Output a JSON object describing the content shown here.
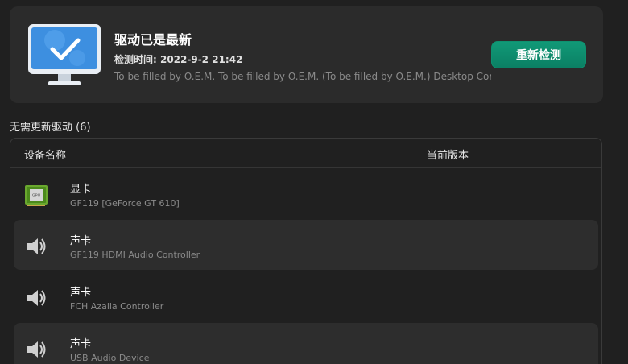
{
  "status": {
    "title": "驱动已是最新",
    "time": "检测时间: 2022-9-2 21:42",
    "description": "To be filled by O.E.M. To be filled by O.E.M. (To be filled by O.E.M.) Desktop Computer",
    "button_label": "重新检测"
  },
  "section": {
    "title": "无需更新驱动 (6)"
  },
  "table": {
    "columns": {
      "name": "设备名称",
      "version": "当前版本"
    },
    "rows": [
      {
        "title": "显卡",
        "subtitle": "GF119 [GeForce GT 610]",
        "icon": "gpu-icon"
      },
      {
        "title": "声卡",
        "subtitle": "GF119 HDMI Audio Controller",
        "icon": "speaker-icon"
      },
      {
        "title": "声卡",
        "subtitle": "FCH Azalia Controller",
        "icon": "speaker-icon"
      },
      {
        "title": "声卡",
        "subtitle": "USB Audio Device",
        "icon": "speaker-icon"
      }
    ]
  },
  "colors": {
    "accent": "#0f8f6f",
    "background": "#202020",
    "card": "#2b2b2b"
  }
}
